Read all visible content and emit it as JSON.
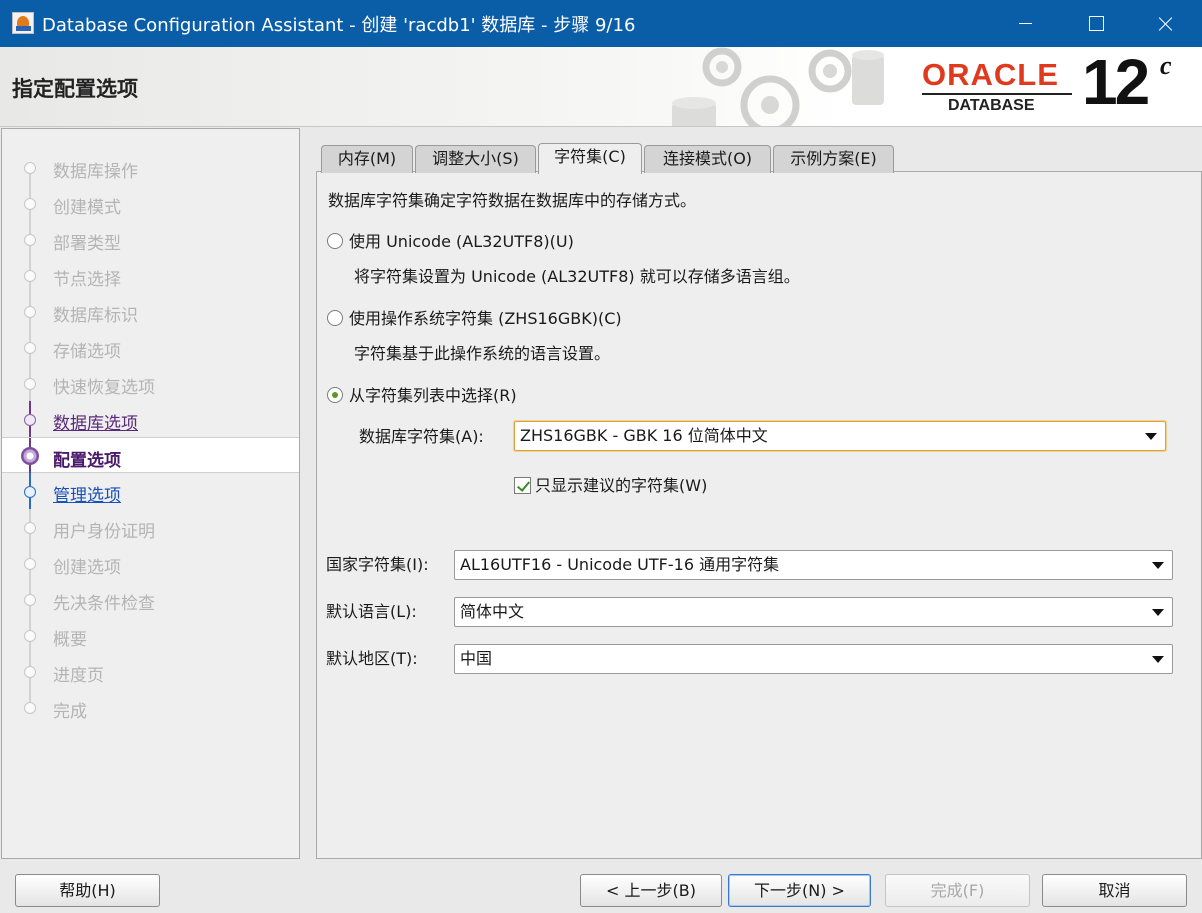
{
  "window": {
    "title": "Database Configuration Assistant - 创建 'racdb1' 数据库 - 步骤 9/16"
  },
  "header": {
    "page_title": "指定配置选项",
    "logo": {
      "brand": "ORACLE",
      "product": "DATABASE",
      "version": "12",
      "version_suffix": "c"
    }
  },
  "steps": [
    {
      "label": "数据库操作",
      "state": "disabled"
    },
    {
      "label": "创建模式",
      "state": "disabled"
    },
    {
      "label": "部署类型",
      "state": "disabled"
    },
    {
      "label": "节点选择",
      "state": "disabled"
    },
    {
      "label": "数据库标识",
      "state": "disabled"
    },
    {
      "label": "存储选项",
      "state": "disabled"
    },
    {
      "label": "快速恢复选项",
      "state": "disabled"
    },
    {
      "label": "数据库选项",
      "state": "done"
    },
    {
      "label": "配置选项",
      "state": "current"
    },
    {
      "label": "管理选项",
      "state": "next"
    },
    {
      "label": "用户身份证明",
      "state": "disabled"
    },
    {
      "label": "创建选项",
      "state": "disabled"
    },
    {
      "label": "先决条件检查",
      "state": "disabled"
    },
    {
      "label": "概要",
      "state": "disabled"
    },
    {
      "label": "进度页",
      "state": "disabled"
    },
    {
      "label": "完成",
      "state": "disabled"
    }
  ],
  "tabs": [
    {
      "label": "内存(M)",
      "active": false
    },
    {
      "label": "调整大小(S)",
      "active": false
    },
    {
      "label": "字符集(C)",
      "active": true
    },
    {
      "label": "连接模式(O)",
      "active": false
    },
    {
      "label": "示例方案(E)",
      "active": false
    }
  ],
  "charset": {
    "description": "数据库字符集确定字符数据在数据库中的存储方式。",
    "options": [
      {
        "label": "使用 Unicode (AL32UTF8)(U)",
        "desc": "将字符集设置为 Unicode (AL32UTF8) 就可以存储多语言组。",
        "selected": false
      },
      {
        "label": "使用操作系统字符集 (ZHS16GBK)(C)",
        "desc": "字符集基于此操作系统的语言设置。",
        "selected": false
      },
      {
        "label": "从字符集列表中选择(R)",
        "desc": "",
        "selected": true
      }
    ],
    "db_charset_label": "数据库字符集(A):",
    "db_charset_value": "ZHS16GBK - GBK 16 位简体中文",
    "show_recommended_label": "只显示建议的字符集(W)",
    "show_recommended_checked": true,
    "national_charset_label": "国家字符集(I):",
    "national_charset_value": "AL16UTF16 - Unicode UTF-16 通用字符集",
    "default_language_label": "默认语言(L):",
    "default_language_value": "简体中文",
    "default_territory_label": "默认地区(T):",
    "default_territory_value": "中国"
  },
  "buttons": {
    "help": "帮助(H)",
    "back": "< 上一步(B)",
    "next": "下一步(N) >",
    "finish": "完成(F)",
    "cancel": "取消"
  }
}
